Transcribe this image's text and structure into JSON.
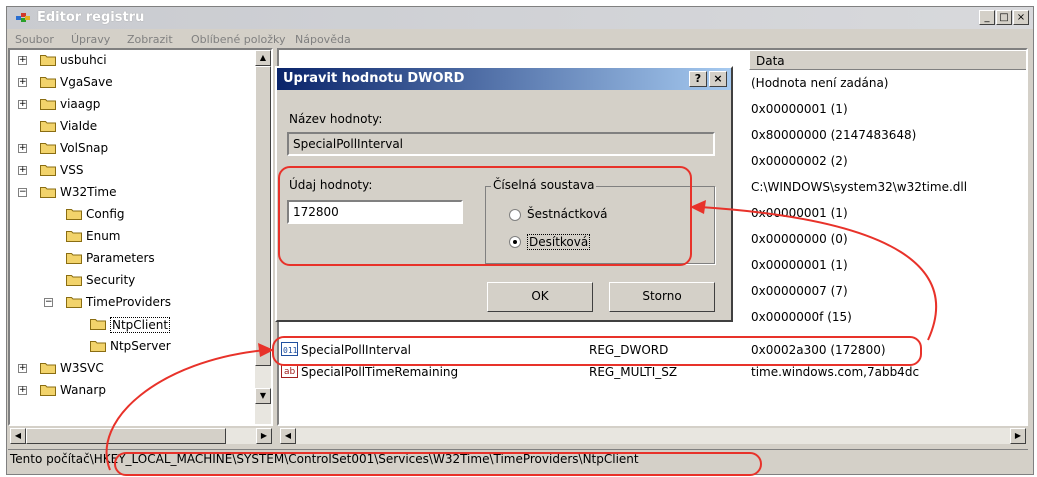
{
  "window": {
    "title": "Editor registru",
    "buttons": [
      "_",
      "□",
      "×"
    ]
  },
  "menu": [
    "Soubor",
    "Úpravy",
    "Zobrazit",
    "Oblíbené položky",
    "Nápověda"
  ],
  "tree": {
    "items": [
      {
        "label": "usbuhci",
        "expand": "+"
      },
      {
        "label": "VgaSave",
        "expand": "+"
      },
      {
        "label": "viaagp",
        "expand": "+"
      },
      {
        "label": "ViaIde",
        "expand": ""
      },
      {
        "label": "VolSnap",
        "expand": "+"
      },
      {
        "label": "VSS",
        "expand": "+"
      },
      {
        "label": "W32Time",
        "expand": "−"
      },
      {
        "label": "Config",
        "expand": ""
      },
      {
        "label": "Enum",
        "expand": ""
      },
      {
        "label": "Parameters",
        "expand": ""
      },
      {
        "label": "Security",
        "expand": ""
      },
      {
        "label": "TimeProviders",
        "expand": "−"
      },
      {
        "label": "NtpClient",
        "expand": ""
      },
      {
        "label": "NtpServer",
        "expand": ""
      },
      {
        "label": "W3SVC",
        "expand": "+"
      },
      {
        "label": "Wanarp",
        "expand": "+"
      }
    ]
  },
  "list": {
    "header_data": "Data",
    "data_values": [
      "(Hodnota není zadána)",
      "0x00000001 (1)",
      "0x80000000 (2147483648)",
      "0x00000002 (2)",
      "C:\\WINDOWS\\system32\\w32time.dll",
      "0x00000001 (1)",
      "0x00000000 (0)",
      "0x00000001 (1)",
      "0x00000007 (7)",
      "0x0000000f (15)"
    ],
    "rows": [
      {
        "name": "SpecialPollInterval",
        "type": "REG_DWORD",
        "data": "0x0002a300 (172800)",
        "icon": "ab-icon"
      },
      {
        "name": "SpecialPollTimeRemaining",
        "type": "REG_MULTI_SZ",
        "data": "time.windows.com,7abb4dc",
        "icon": "ab-icon"
      }
    ]
  },
  "dialog": {
    "title": "Upravit hodnotu DWORD",
    "help": "?",
    "close": "×",
    "name_label": "Název hodnoty:",
    "name_value": "SpecialPollInterval",
    "value_label": "Údaj hodnoty:",
    "value_value": "172800",
    "base_label": "Číselná soustava",
    "hex_label": "Šestnáctková",
    "dec_label": "Desítková",
    "selected_base": "dec",
    "ok": "OK",
    "cancel": "Storno"
  },
  "statusbar": {
    "path": "Tento počítač\\HKEY_LOCAL_MACHINE\\SYSTEM\\ControlSet001\\Services\\W32Time\\TimeProviders\\NtpClient"
  },
  "colors": {
    "annotation": "#e8322a",
    "selection": "#0a246a"
  }
}
